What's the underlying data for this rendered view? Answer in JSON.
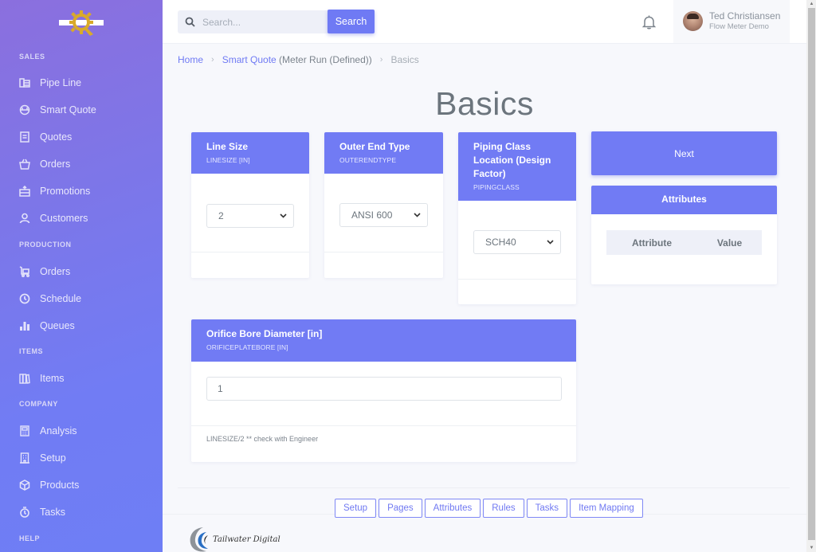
{
  "sidebar": {
    "sections": [
      {
        "label": "SALES",
        "items": [
          {
            "label": "Pipe Line",
            "icon": "pipeline-icon"
          },
          {
            "label": "Smart Quote",
            "icon": "helmet-icon"
          },
          {
            "label": "Quotes",
            "icon": "receipt-icon"
          },
          {
            "label": "Orders",
            "icon": "basket-icon"
          },
          {
            "label": "Promotions",
            "icon": "gift-box-icon"
          },
          {
            "label": "Customers",
            "icon": "user-icon"
          }
        ]
      },
      {
        "label": "PRODUCTION",
        "items": [
          {
            "label": "Orders",
            "icon": "cart-icon"
          },
          {
            "label": "Schedule",
            "icon": "clock-icon"
          },
          {
            "label": "Queues",
            "icon": "bar-chart-icon"
          }
        ]
      },
      {
        "label": "ITEMS",
        "items": [
          {
            "label": "Items",
            "icon": "books-icon"
          }
        ]
      },
      {
        "label": "COMPANY",
        "items": [
          {
            "label": "Analysis",
            "icon": "calculator-icon"
          },
          {
            "label": "Setup",
            "icon": "building-icon"
          },
          {
            "label": "Products",
            "icon": "cube-icon"
          },
          {
            "label": "Tasks",
            "icon": "stopwatch-icon"
          }
        ]
      },
      {
        "label": "HELP",
        "items": []
      }
    ]
  },
  "header": {
    "search_placeholder": "Search...",
    "search_value": "",
    "search_button": "Search",
    "user_name": "Ted Christiansen",
    "user_subtitle": "Flow Meter Demo"
  },
  "breadcrumb": {
    "home": "Home",
    "smart_quote": "Smart Quote",
    "context": " (Meter Run (Defined))",
    "current": "Basics"
  },
  "page_title": "Basics",
  "fields": {
    "line_size": {
      "title": "Line Size",
      "code": "LINESIZE [IN]",
      "value": "2"
    },
    "outer_end_type": {
      "title": "Outer End Type",
      "code": "OUTERENDTYPE",
      "value": "ANSI 600"
    },
    "piping_class": {
      "title": "Piping Class Location (Design Factor)",
      "code": "PIPINGCLASS",
      "value": "SCH40"
    },
    "orifice_bore": {
      "title": "Orifice Bore Diameter [in]",
      "code": "ORIFICEPLATEBORE [IN]",
      "value": "1",
      "note": "LINESIZE/2 ** check with Engineer"
    }
  },
  "next_button": "Next",
  "attributes": {
    "title": "Attributes",
    "columns": [
      "Attribute",
      "Value"
    ],
    "rows": []
  },
  "footer": {
    "tabs": [
      "Setup",
      "Pages",
      "Attributes",
      "Rules",
      "Tasks",
      "Item Mapping"
    ],
    "brand": "Tailwater Digital"
  },
  "colors": {
    "accent": "#717bf4",
    "sidebar_top": "#8b6fde",
    "sidebar_bottom": "#6e7ef5",
    "logo_gear": "#d9aa2a"
  }
}
